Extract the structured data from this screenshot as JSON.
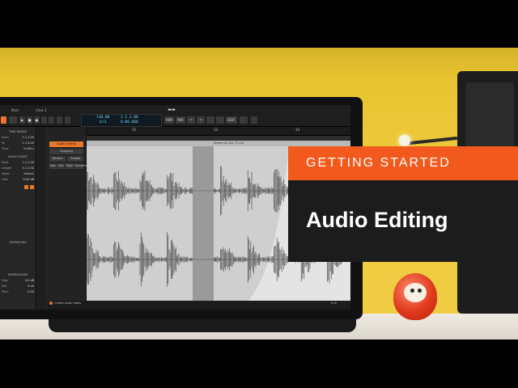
{
  "overlay": {
    "kicker": "GETTING STARTED",
    "title": "Audio Editing"
  },
  "daw": {
    "tabs": [
      "Main",
      "View 3"
    ],
    "transport": {
      "tempo": "110.00",
      "time_sig": "4/4",
      "position": "1.1.1.00",
      "time": "0:00.000"
    },
    "toolbar_buttons": [
      "ARR",
      "MIX",
      "EDIT"
    ],
    "inspector": {
      "time_range_header": "TIME RANGE",
      "rows": [
        {
          "k": "From",
          "v": "1.1.1.00"
        },
        {
          "k": "To",
          "v": "1.1.4.00"
        },
        {
          "k": "Time",
          "v": "2.004 s"
        }
      ],
      "audio_event_header": "AUDIO EVENT",
      "event_rows": [
        {
          "k": "Start",
          "v": "1.1.1.00"
        },
        {
          "k": "Length",
          "v": "0.1.2.00"
        },
        {
          "k": "Mode",
          "v": "Stretch"
        },
        {
          "k": "Gain",
          "v": "0.00 dB"
        }
      ],
      "operators_header": "OPERATORS",
      "expressions_header": "EXPRESSIONS",
      "expr_rows": [
        {
          "k": "Gain",
          "v": "0.0 dB"
        },
        {
          "k": "Pan",
          "v": "0.00"
        },
        {
          "k": "Pitch",
          "v": "0.00"
        }
      ]
    },
    "track_tabs": [
      "Audio Events",
      "Comping",
      "Stretch",
      "Onsets",
      "Gain",
      "Pan",
      "Pitch",
      "Formant"
    ],
    "ruler_marks": [
      "12",
      "13",
      "14"
    ],
    "clip_name": "Steam Kit 1b2 77-0.b",
    "status": "Create audio fades",
    "zoom": "1/16"
  },
  "colors": {
    "accent": "#e8772a",
    "overlay_orange": "#f15a1c",
    "overlay_dark": "#1c1c1c",
    "wall_yellow": "#edc83a"
  }
}
